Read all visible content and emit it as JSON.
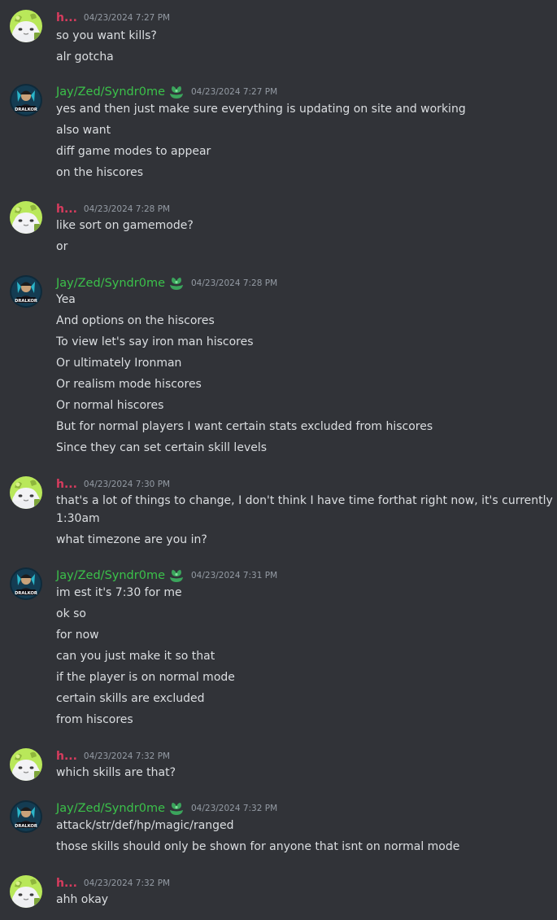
{
  "messages": [
    {
      "author": "h...",
      "author_kind": "h",
      "timestamp": "04/23/2024 7:27 PM",
      "lines": [
        "so you want kills?",
        "alr gotcha"
      ]
    },
    {
      "author": "Jay/Zed/Syndr0me",
      "author_kind": "jay",
      "timestamp": "04/23/2024 7:27 PM",
      "lines": [
        "yes and then just make sure everything is updating on site and working",
        "also want",
        "diff game modes to appear",
        "on the hiscores"
      ]
    },
    {
      "author": "h...",
      "author_kind": "h",
      "timestamp": "04/23/2024 7:28 PM",
      "lines": [
        "like sort on gamemode?",
        "or"
      ]
    },
    {
      "author": "Jay/Zed/Syndr0me",
      "author_kind": "jay",
      "timestamp": "04/23/2024 7:28 PM",
      "lines": [
        "Yea",
        "And options on the hiscores",
        "To view let's say iron man hiscores",
        "Or ultimately Ironman",
        "Or realism mode hiscores",
        "Or normal hiscores",
        "But for normal players I want certain stats excluded from hiscores",
        "Since they can set certain skill levels"
      ]
    },
    {
      "author": "h...",
      "author_kind": "h",
      "timestamp": "04/23/2024 7:30 PM",
      "lines": [
        "that's a lot of things to change, I don't think I have time forthat right now, it's currently",
        "1:30am",
        "what timezone are you in?"
      ]
    },
    {
      "author": "Jay/Zed/Syndr0me",
      "author_kind": "jay",
      "timestamp": "04/23/2024 7:31 PM",
      "lines": [
        "im est it's 7:30 for me",
        "ok so",
        "for now",
        "can you just make it so that",
        "if the player is on normal mode",
        "certain skills are excluded",
        "from hiscores"
      ]
    },
    {
      "author": "h...",
      "author_kind": "h",
      "timestamp": "04/23/2024 7:32 PM",
      "lines": [
        "which skills are that?"
      ]
    },
    {
      "author": "Jay/Zed/Syndr0me",
      "author_kind": "jay",
      "timestamp": "04/23/2024 7:32 PM",
      "lines": [
        "attack/str/def/hp/magic/ranged",
        "those skills should only be shown for anyone that isnt on normal mode"
      ]
    },
    {
      "author": "h...",
      "author_kind": "h",
      "timestamp": "04/23/2024 7:32 PM",
      "lines": [
        "ahh okay"
      ]
    }
  ],
  "avatar_text": "DRALKOR",
  "colors": {
    "background": "#313338",
    "h_name": "#d83c5e",
    "jay_name": "#3bc14a",
    "timestamp": "#949ba4",
    "text": "#dbdee1"
  }
}
